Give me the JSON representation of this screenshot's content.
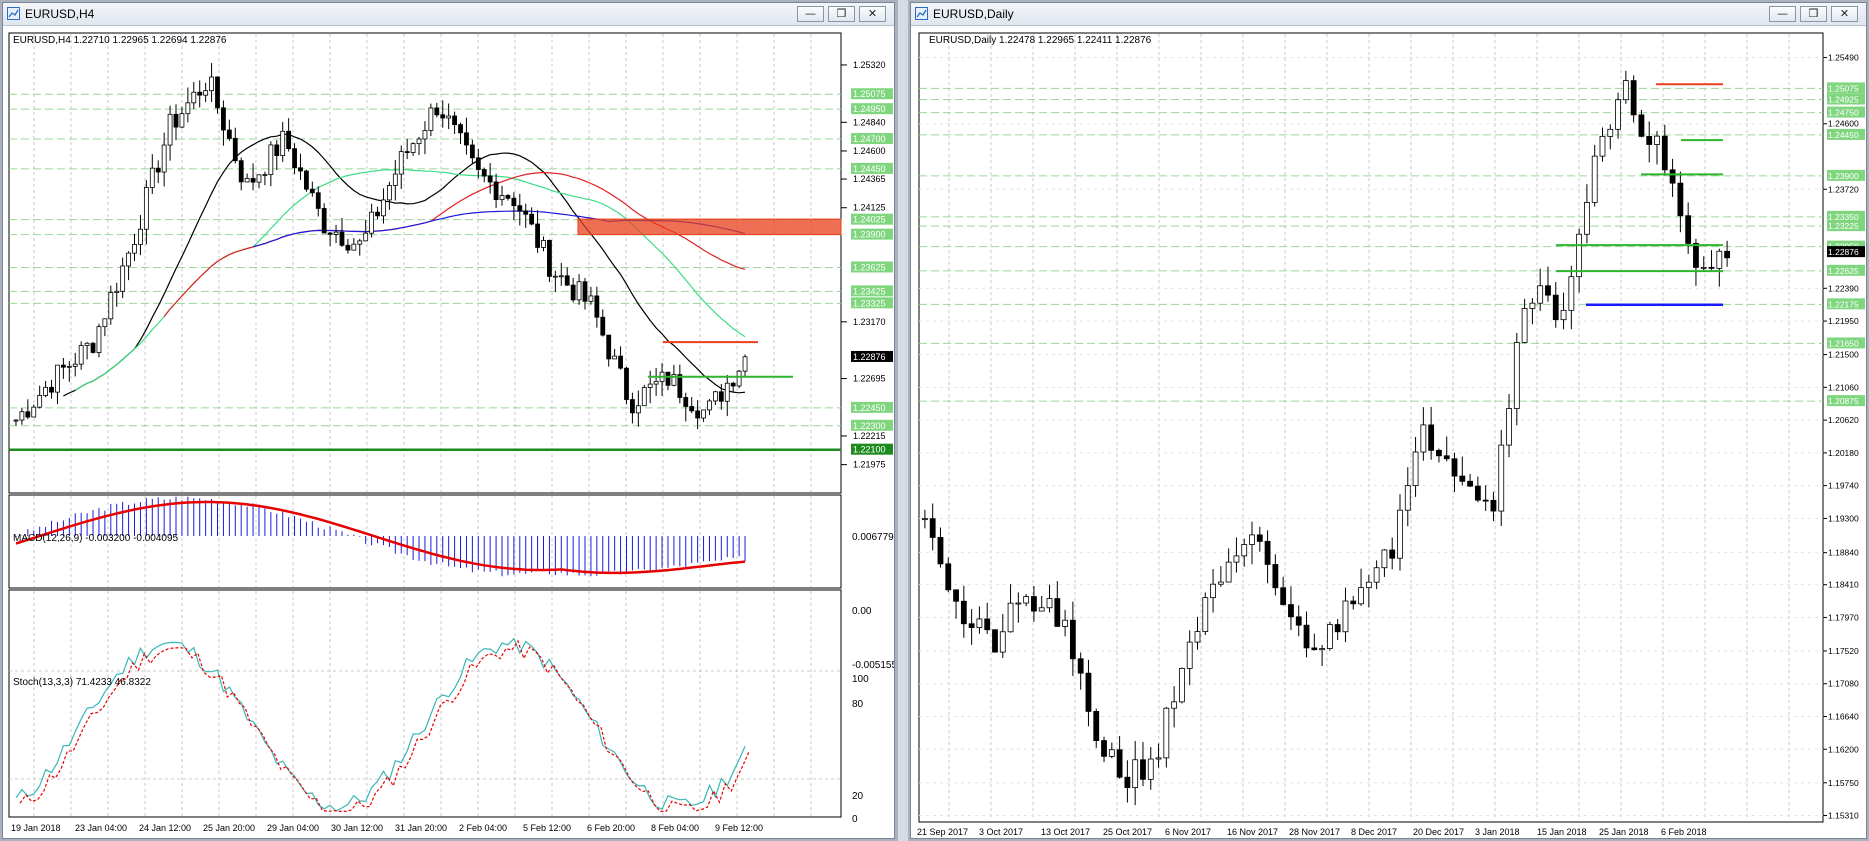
{
  "colors": {
    "bear": "#000000",
    "bull": "#ffffff",
    "grid": "#c8c8c8",
    "pricebox": "#7fd67f",
    "pricetext": "#ffffff",
    "current": "#000000",
    "red": "#e8401b",
    "green": "#2db52d",
    "blue": "#1a1aff",
    "macd": "#1a1adb",
    "signal": "#e80000",
    "stoch_main": "#38b6b6",
    "stoch_sig": "#e80000",
    "ma_black": "#000000",
    "ma_green": "#3ddc84",
    "ma_red": "#e02020",
    "ma_blue": "#1a1adb"
  },
  "icons": {
    "chart": "chart-window-icon",
    "minimize": "minimize-icon",
    "restore": "restore-icon",
    "close": "close-icon",
    "dropdown": "dropdown-triangle-icon"
  },
  "left": {
    "title": "EURUSD,H4",
    "header": "EURUSD,H4  1.22710 1.22965 1.22694 1.22876",
    "buttons": {
      "min": "—",
      "restore": "❐",
      "close": "✕"
    },
    "price_labels": [
      {
        "text": "1.25320",
        "box": false
      },
      {
        "text": "1.25075",
        "box": true
      },
      {
        "text": "1.24950",
        "box": true
      },
      {
        "text": "1.24840",
        "box": false
      },
      {
        "text": "1.24700",
        "box": true
      },
      {
        "text": "1.24600",
        "box": false
      },
      {
        "text": "1.24450",
        "box": true
      },
      {
        "text": "1.24365",
        "box": false
      },
      {
        "text": "1.24125",
        "box": false
      },
      {
        "text": "1.24025",
        "box": true
      },
      {
        "text": "1.23900",
        "box": true
      },
      {
        "text": "1.23625",
        "box": true
      },
      {
        "text": "1.23425",
        "box": true
      },
      {
        "text": "1.23325",
        "box": true
      },
      {
        "text": "1.23170",
        "box": false
      },
      {
        "text": "1.22876",
        "box": "current"
      },
      {
        "text": "1.22695",
        "box": false
      },
      {
        "text": "1.22450",
        "box": true
      },
      {
        "text": "1.22300",
        "box": true
      },
      {
        "text": "1.22215",
        "box": false
      },
      {
        "text": "1.22100",
        "box": "line"
      },
      {
        "text": "1.21975",
        "box": false
      }
    ],
    "macd": {
      "label": "MACD(12,26,9) -0.003200 -0.004095",
      "top": "0.006779",
      "zero": "0.00",
      "bottom": "-0.005155"
    },
    "stoch": {
      "label": "Stoch(13,3,3) 71.4233 46.8322",
      "l100": "100",
      "l80": "80",
      "l20": "20",
      "l0": "0"
    },
    "time_labels": [
      "19 Jan 2018",
      "23 Jan 04:00",
      "24 Jan 12:00",
      "25 Jan 20:00",
      "29 Jan 04:00",
      "30 Jan 12:00",
      "31 Jan 20:00",
      "2 Feb 04:00",
      "5 Feb 12:00",
      "6 Feb 20:00",
      "8 Feb 04:00",
      "9 Feb 12:00"
    ]
  },
  "right": {
    "title": "EURUSD,Daily",
    "header": "EURUSD,Daily  1.22478 1.22965 1.22411 1.22876",
    "buttons": {
      "min": "—",
      "restore": "❐",
      "close": "✕"
    },
    "price_labels": [
      {
        "text": "1.25490",
        "box": false
      },
      {
        "text": "1.25075",
        "box": true
      },
      {
        "text": "1.24925",
        "box": true
      },
      {
        "text": "1.24750",
        "box": true
      },
      {
        "text": "1.24600",
        "box": false
      },
      {
        "text": "1.24450",
        "box": true
      },
      {
        "text": "1.23900",
        "box": true
      },
      {
        "text": "1.23720",
        "box": false
      },
      {
        "text": "1.23350",
        "box": true
      },
      {
        "text": "1.23225",
        "box": true
      },
      {
        "text": "1.22950",
        "box": true
      },
      {
        "text": "1.22876",
        "box": "current"
      },
      {
        "text": "1.22625",
        "box": true
      },
      {
        "text": "1.22390",
        "box": false
      },
      {
        "text": "1.22175",
        "box": true
      },
      {
        "text": "1.21950",
        "box": false
      },
      {
        "text": "1.21650",
        "box": true
      },
      {
        "text": "1.21500",
        "box": false
      },
      {
        "text": "1.21060",
        "box": false
      },
      {
        "text": "1.20875",
        "box": true
      },
      {
        "text": "1.20620",
        "box": false
      },
      {
        "text": "1.20180",
        "box": false
      },
      {
        "text": "1.19740",
        "box": false
      },
      {
        "text": "1.19300",
        "box": false
      },
      {
        "text": "1.18840",
        "box": false
      },
      {
        "text": "1.18410",
        "box": false
      },
      {
        "text": "1.17970",
        "box": false
      },
      {
        "text": "1.17520",
        "box": false
      },
      {
        "text": "1.17080",
        "box": false
      },
      {
        "text": "1.16640",
        "box": false
      },
      {
        "text": "1.16200",
        "box": false
      },
      {
        "text": "1.15750",
        "box": false
      },
      {
        "text": "1.15310",
        "box": false
      }
    ],
    "time_labels": [
      "21 Sep 2017",
      "3 Oct 2017",
      "13 Oct 2017",
      "25 Oct 2017",
      "6 Nov 2017",
      "16 Nov 2017",
      "28 Nov 2017",
      "8 Dec 2017",
      "20 Dec 2017",
      "3 Jan 2018",
      "15 Jan 2018",
      "25 Jan 2018",
      "6 Feb 2018"
    ]
  }
}
